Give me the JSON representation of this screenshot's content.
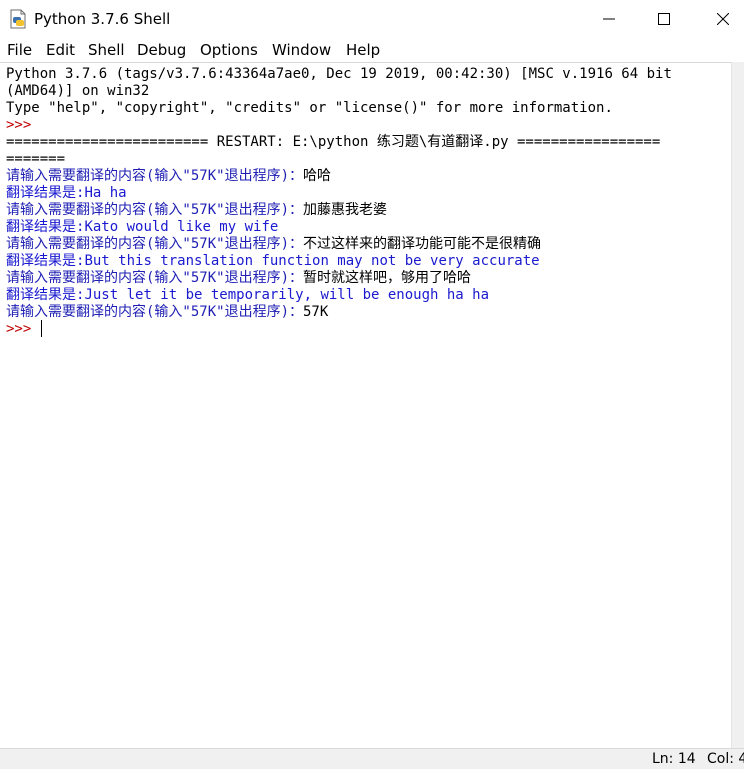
{
  "window": {
    "title": "Python 3.7.6 Shell",
    "minimize_icon": "minimize-icon",
    "maximize_icon": "maximize-icon",
    "close_icon": "close-icon"
  },
  "menu": {
    "items": [
      {
        "label": "File"
      },
      {
        "label": "Edit"
      },
      {
        "label": "Shell"
      },
      {
        "label": "Debug"
      },
      {
        "label": "Options"
      },
      {
        "label": "Window"
      },
      {
        "label": "Help"
      }
    ]
  },
  "shell": {
    "banner1": "Python 3.7.6 (tags/v3.7.6:43364a7ae0, Dec 19 2019, 00:42:30) [MSC v.1916 64 bit",
    "banner2": "(AMD64)] on win32",
    "banner3": "Type \"help\", \"copyright\", \"credits\" or \"license()\" for more information.",
    "prompt": ">>>",
    "restart_line1": "======================== RESTART: E:\\python 练习题\\有道翻译.py =================",
    "restart_line2": "=======",
    "prompt_text": "请输入需要翻译的内容(输入\"57K\"退出程序)：",
    "result_prefix": "翻译结果是:",
    "exchanges": [
      {
        "input": "哈哈",
        "output": "Ha ha"
      },
      {
        "input": "加藤惠我老婆",
        "output": "Kato would like my wife"
      },
      {
        "input": "不过这样来的翻译功能可能不是很精确",
        "output": "But this translation function may not be very accurate"
      },
      {
        "input": "暂时就这样吧，够用了哈哈",
        "output": "Just let it be temporarily, will be enough ha ha"
      }
    ],
    "final_input": "57K",
    "final_prompt": ">>>"
  },
  "status": {
    "ln": "Ln: 14",
    "col": "Col: 4"
  }
}
